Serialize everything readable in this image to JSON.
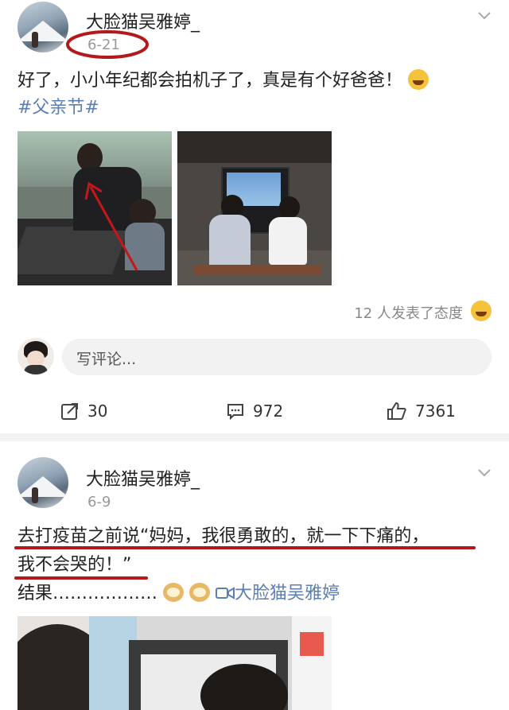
{
  "post1": {
    "username": "大脸猫吴雅婷_",
    "date": "6-21",
    "text": "好了，小小年纪都会拍机子了，真是有个好爸爸！",
    "hashtag": "#父亲节#",
    "reactions_text": "12 人发表了态度",
    "comment_placeholder": "写评论...",
    "actions": {
      "repost_count": "30",
      "comment_count": "972",
      "like_count": "7361"
    },
    "icons": {
      "repost": "share-icon",
      "comment": "comment-icon",
      "like": "like-icon",
      "reaction": "laughing-emoji-icon",
      "text_emoji": "tears-of-joy-emoji-icon"
    }
  },
  "post2": {
    "username": "大脸猫吴雅婷_",
    "date": "6-9",
    "text_line1": "去打疫苗之前说“妈妈，我很勇敢的，就一下下痛的，",
    "text_line2": "我不会哭的！”",
    "text_line3_prefix": "结果………………",
    "mention": "大脸猫吴雅婷",
    "icons": {
      "doge": "doge-emoji-icon",
      "mention": "video-camera-icon"
    }
  },
  "colors": {
    "hashtag": "#5b7fb5",
    "annotation_red": "#b3181d",
    "muted": "#999999"
  }
}
